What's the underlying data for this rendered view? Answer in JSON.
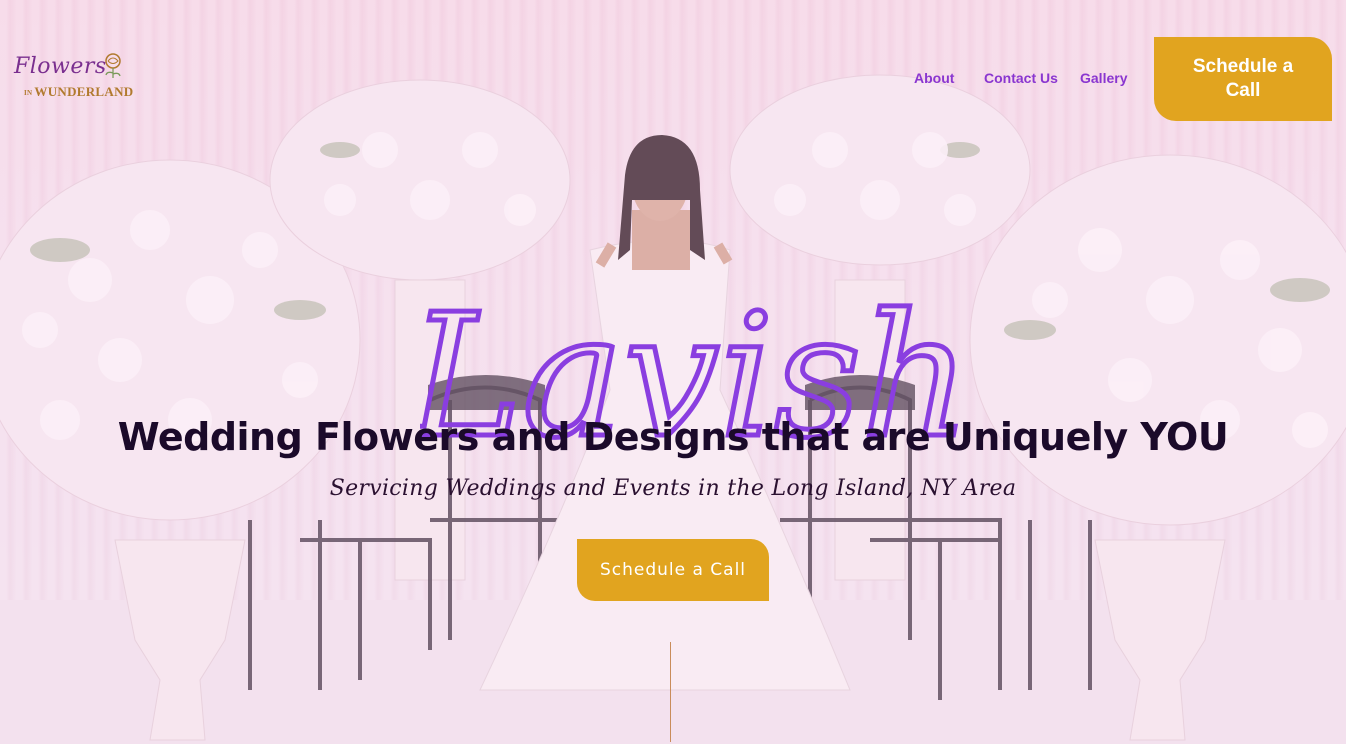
{
  "brand": {
    "logo_script": "Flowers",
    "logo_in": "IN",
    "logo_sub": "WUNDERLAND"
  },
  "nav": {
    "about": "About",
    "contact": "Contact Us",
    "gallery": "Gallery",
    "cta": "Schedule a Call"
  },
  "hero": {
    "script_word": "Lavish",
    "headline": "Wedding Flowers and Designs that are Uniquely YOU",
    "subheadline": "Servicing Weddings and Events in the Long Island, NY Area",
    "cta": "Schedule a Call"
  },
  "colors": {
    "accent": "#e1a41f",
    "nav_text": "#8a36d0",
    "script_purple": "#8a3ee0"
  }
}
